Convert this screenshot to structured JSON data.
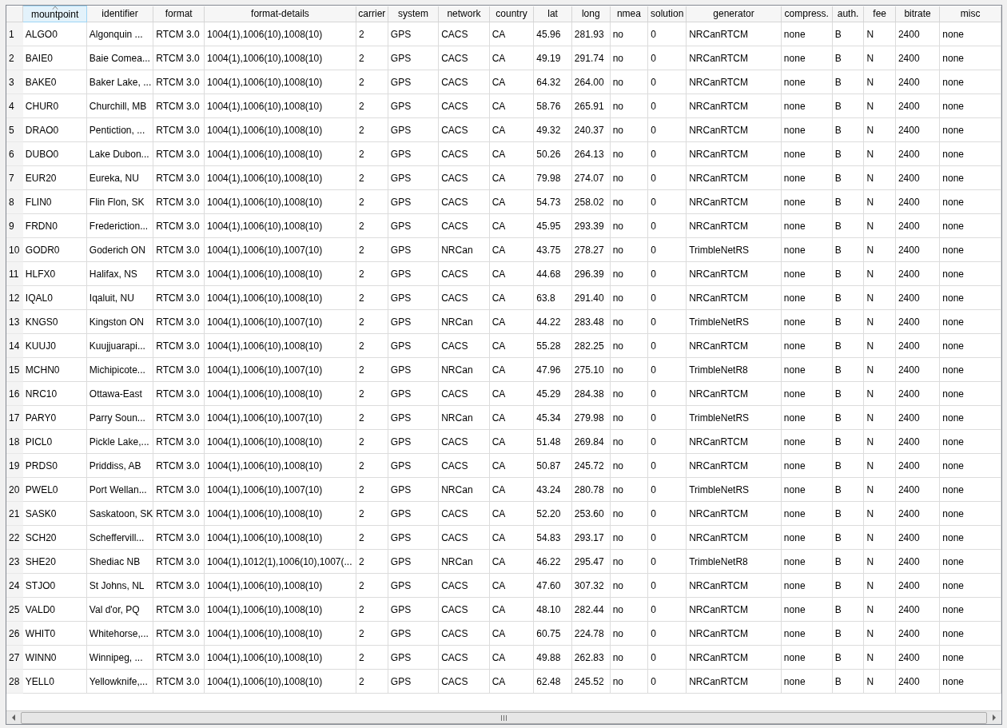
{
  "table": {
    "columns": [
      {
        "label": "mountpoint",
        "sorted": true
      },
      {
        "label": "identifier",
        "sorted": false
      },
      {
        "label": "format",
        "sorted": false
      },
      {
        "label": "format-details",
        "sorted": false
      },
      {
        "label": "carrier",
        "sorted": false
      },
      {
        "label": "system",
        "sorted": false
      },
      {
        "label": "network",
        "sorted": false
      },
      {
        "label": "country",
        "sorted": false
      },
      {
        "label": "lat",
        "sorted": false
      },
      {
        "label": "long",
        "sorted": false
      },
      {
        "label": "nmea",
        "sorted": false
      },
      {
        "label": "solution",
        "sorted": false
      },
      {
        "label": "generator",
        "sorted": false
      },
      {
        "label": "compress.",
        "sorted": false
      },
      {
        "label": "auth.",
        "sorted": false
      },
      {
        "label": "fee",
        "sorted": false
      },
      {
        "label": "bitrate",
        "sorted": false
      },
      {
        "label": "misc",
        "sorted": false
      }
    ],
    "rows": [
      {
        "number": "1",
        "cells": [
          "ALGO0",
          "Algonquin ...",
          "RTCM 3.0",
          "1004(1),1006(10),1008(10)",
          "2",
          "GPS",
          "CACS",
          "CA",
          "45.96",
          "281.93",
          "no",
          "0",
          "NRCanRTCM",
          "none",
          "B",
          "N",
          "2400",
          "none"
        ]
      },
      {
        "number": "2",
        "cells": [
          "BAIE0",
          "Baie Comea...",
          "RTCM 3.0",
          "1004(1),1006(10),1008(10)",
          "2",
          "GPS",
          "CACS",
          "CA",
          "49.19",
          "291.74",
          "no",
          "0",
          "NRCanRTCM",
          "none",
          "B",
          "N",
          "2400",
          "none"
        ]
      },
      {
        "number": "3",
        "cells": [
          "BAKE0",
          "Baker Lake, ...",
          "RTCM 3.0",
          "1004(1),1006(10),1008(10)",
          "2",
          "GPS",
          "CACS",
          "CA",
          "64.32",
          "264.00",
          "no",
          "0",
          "NRCanRTCM",
          "none",
          "B",
          "N",
          "2400",
          "none"
        ]
      },
      {
        "number": "4",
        "cells": [
          "CHUR0",
          "Churchill, MB",
          "RTCM 3.0",
          "1004(1),1006(10),1008(10)",
          "2",
          "GPS",
          "CACS",
          "CA",
          "58.76",
          "265.91",
          "no",
          "0",
          "NRCanRTCM",
          "none",
          "B",
          "N",
          "2400",
          "none"
        ]
      },
      {
        "number": "5",
        "cells": [
          "DRAO0",
          "Pentiction, ...",
          "RTCM 3.0",
          "1004(1),1006(10),1008(10)",
          "2",
          "GPS",
          "CACS",
          "CA",
          "49.32",
          "240.37",
          "no",
          "0",
          "NRCanRTCM",
          "none",
          "B",
          "N",
          "2400",
          "none"
        ]
      },
      {
        "number": "6",
        "cells": [
          "DUBO0",
          "Lake Dubon...",
          "RTCM 3.0",
          "1004(1),1006(10),1008(10)",
          "2",
          "GPS",
          "CACS",
          "CA",
          "50.26",
          "264.13",
          "no",
          "0",
          "NRCanRTCM",
          "none",
          "B",
          "N",
          "2400",
          "none"
        ]
      },
      {
        "number": "7",
        "cells": [
          "EUR20",
          "Eureka, NU",
          "RTCM 3.0",
          "1004(1),1006(10),1008(10)",
          "2",
          "GPS",
          "CACS",
          "CA",
          "79.98",
          "274.07",
          "no",
          "0",
          "NRCanRTCM",
          "none",
          "B",
          "N",
          "2400",
          "none"
        ]
      },
      {
        "number": "8",
        "cells": [
          "FLIN0",
          "Flin Flon, SK",
          "RTCM 3.0",
          "1004(1),1006(10),1008(10)",
          "2",
          "GPS",
          "CACS",
          "CA",
          "54.73",
          "258.02",
          "no",
          "0",
          "NRCanRTCM",
          "none",
          "B",
          "N",
          "2400",
          "none"
        ]
      },
      {
        "number": "9",
        "cells": [
          "FRDN0",
          "Frederiction...",
          "RTCM 3.0",
          "1004(1),1006(10),1008(10)",
          "2",
          "GPS",
          "CACS",
          "CA",
          "45.95",
          "293.39",
          "no",
          "0",
          "NRCanRTCM",
          "none",
          "B",
          "N",
          "2400",
          "none"
        ]
      },
      {
        "number": "10",
        "cells": [
          "GODR0",
          "Goderich ON",
          "RTCM 3.0",
          "1004(1),1006(10),1007(10)",
          "2",
          "GPS",
          "NRCan",
          "CA",
          "43.75",
          "278.27",
          "no",
          "0",
          "TrimbleNetRS",
          "none",
          "B",
          "N",
          "2400",
          "none"
        ]
      },
      {
        "number": "11",
        "cells": [
          "HLFX0",
          "Halifax, NS",
          "RTCM 3.0",
          "1004(1),1006(10),1008(10)",
          "2",
          "GPS",
          "CACS",
          "CA",
          "44.68",
          "296.39",
          "no",
          "0",
          "NRCanRTCM",
          "none",
          "B",
          "N",
          "2400",
          "none"
        ]
      },
      {
        "number": "12",
        "cells": [
          "IQAL0",
          "Iqaluit, NU",
          "RTCM 3.0",
          "1004(1),1006(10),1008(10)",
          "2",
          "GPS",
          "CACS",
          "CA",
          "63.8",
          "291.40",
          "no",
          "0",
          "NRCanRTCM",
          "none",
          "B",
          "N",
          "2400",
          "none"
        ]
      },
      {
        "number": "13",
        "cells": [
          "KNGS0",
          "Kingston ON",
          "RTCM 3.0",
          "1004(1),1006(10),1007(10)",
          "2",
          "GPS",
          "NRCan",
          "CA",
          "44.22",
          "283.48",
          "no",
          "0",
          "TrimbleNetRS",
          "none",
          "B",
          "N",
          "2400",
          "none"
        ]
      },
      {
        "number": "14",
        "cells": [
          "KUUJ0",
          "Kuujjuarapi...",
          "RTCM 3.0",
          "1004(1),1006(10),1008(10)",
          "2",
          "GPS",
          "CACS",
          "CA",
          "55.28",
          "282.25",
          "no",
          "0",
          "NRCanRTCM",
          "none",
          "B",
          "N",
          "2400",
          "none"
        ]
      },
      {
        "number": "15",
        "cells": [
          "MCHN0",
          "Michipicote...",
          "RTCM 3.0",
          "1004(1),1006(10),1007(10)",
          "2",
          "GPS",
          "NRCan",
          "CA",
          "47.96",
          "275.10",
          "no",
          "0",
          "TrimbleNetR8",
          "none",
          "B",
          "N",
          "2400",
          "none"
        ]
      },
      {
        "number": "16",
        "cells": [
          "NRC10",
          "Ottawa-East",
          "RTCM 3.0",
          "1004(1),1006(10),1008(10)",
          "2",
          "GPS",
          "CACS",
          "CA",
          "45.29",
          "284.38",
          "no",
          "0",
          "NRCanRTCM",
          "none",
          "B",
          "N",
          "2400",
          "none"
        ]
      },
      {
        "number": "17",
        "cells": [
          "PARY0",
          "Parry Soun...",
          "RTCM 3.0",
          "1004(1),1006(10),1007(10)",
          "2",
          "GPS",
          "NRCan",
          "CA",
          "45.34",
          "279.98",
          "no",
          "0",
          "TrimbleNetRS",
          "none",
          "B",
          "N",
          "2400",
          "none"
        ]
      },
      {
        "number": "18",
        "cells": [
          "PICL0",
          "Pickle Lake,...",
          "RTCM 3.0",
          "1004(1),1006(10),1008(10)",
          "2",
          "GPS",
          "CACS",
          "CA",
          "51.48",
          "269.84",
          "no",
          "0",
          "NRCanRTCM",
          "none",
          "B",
          "N",
          "2400",
          "none"
        ]
      },
      {
        "number": "19",
        "cells": [
          "PRDS0",
          "Priddiss, AB",
          "RTCM 3.0",
          "1004(1),1006(10),1008(10)",
          "2",
          "GPS",
          "CACS",
          "CA",
          "50.87",
          "245.72",
          "no",
          "0",
          "NRCanRTCM",
          "none",
          "B",
          "N",
          "2400",
          "none"
        ]
      },
      {
        "number": "20",
        "cells": [
          "PWEL0",
          "Port Wellan...",
          "RTCM 3.0",
          "1004(1),1006(10),1007(10)",
          "2",
          "GPS",
          "NRCan",
          "CA",
          "43.24",
          "280.78",
          "no",
          "0",
          "TrimbleNetRS",
          "none",
          "B",
          "N",
          "2400",
          "none"
        ]
      },
      {
        "number": "21",
        "cells": [
          "SASK0",
          "Saskatoon, SK",
          "RTCM 3.0",
          "1004(1),1006(10),1008(10)",
          "2",
          "GPS",
          "CACS",
          "CA",
          "52.20",
          "253.60",
          "no",
          "0",
          "NRCanRTCM",
          "none",
          "B",
          "N",
          "2400",
          "none"
        ]
      },
      {
        "number": "22",
        "cells": [
          "SCH20",
          "Scheffervill...",
          "RTCM 3.0",
          "1004(1),1006(10),1008(10)",
          "2",
          "GPS",
          "CACS",
          "CA",
          "54.83",
          "293.17",
          "no",
          "0",
          "NRCanRTCM",
          "none",
          "B",
          "N",
          "2400",
          "none"
        ]
      },
      {
        "number": "23",
        "cells": [
          "SHE20",
          "Shediac NB",
          "RTCM 3.0",
          "1004(1),1012(1),1006(10),1007(...",
          "2",
          "GPS",
          "NRCan",
          "CA",
          "46.22",
          "295.47",
          "no",
          "0",
          "TrimbleNetR8",
          "none",
          "B",
          "N",
          "2400",
          "none"
        ]
      },
      {
        "number": "24",
        "cells": [
          "STJO0",
          "St Johns, NL",
          "RTCM 3.0",
          "1004(1),1006(10),1008(10)",
          "2",
          "GPS",
          "CACS",
          "CA",
          "47.60",
          "307.32",
          "no",
          "0",
          "NRCanRTCM",
          "none",
          "B",
          "N",
          "2400",
          "none"
        ]
      },
      {
        "number": "25",
        "cells": [
          "VALD0",
          "Val d'or, PQ",
          "RTCM 3.0",
          "1004(1),1006(10),1008(10)",
          "2",
          "GPS",
          "CACS",
          "CA",
          "48.10",
          "282.44",
          "no",
          "0",
          "NRCanRTCM",
          "none",
          "B",
          "N",
          "2400",
          "none"
        ]
      },
      {
        "number": "26",
        "cells": [
          "WHIT0",
          "Whitehorse,...",
          "RTCM 3.0",
          "1004(1),1006(10),1008(10)",
          "2",
          "GPS",
          "CACS",
          "CA",
          "60.75",
          "224.78",
          "no",
          "0",
          "NRCanRTCM",
          "none",
          "B",
          "N",
          "2400",
          "none"
        ]
      },
      {
        "number": "27",
        "cells": [
          "WINN0",
          "Winnipeg, ...",
          "RTCM 3.0",
          "1004(1),1006(10),1008(10)",
          "2",
          "GPS",
          "CACS",
          "CA",
          "49.88",
          "262.83",
          "no",
          "0",
          "NRCanRTCM",
          "none",
          "B",
          "N",
          "2400",
          "none"
        ]
      },
      {
        "number": "28",
        "cells": [
          "YELL0",
          "Yellowknife,...",
          "RTCM 3.0",
          "1004(1),1006(10),1008(10)",
          "2",
          "GPS",
          "CACS",
          "CA",
          "62.48",
          "245.52",
          "no",
          "0",
          "NRCanRTCM",
          "none",
          "B",
          "N",
          "2400",
          "none"
        ]
      }
    ]
  }
}
